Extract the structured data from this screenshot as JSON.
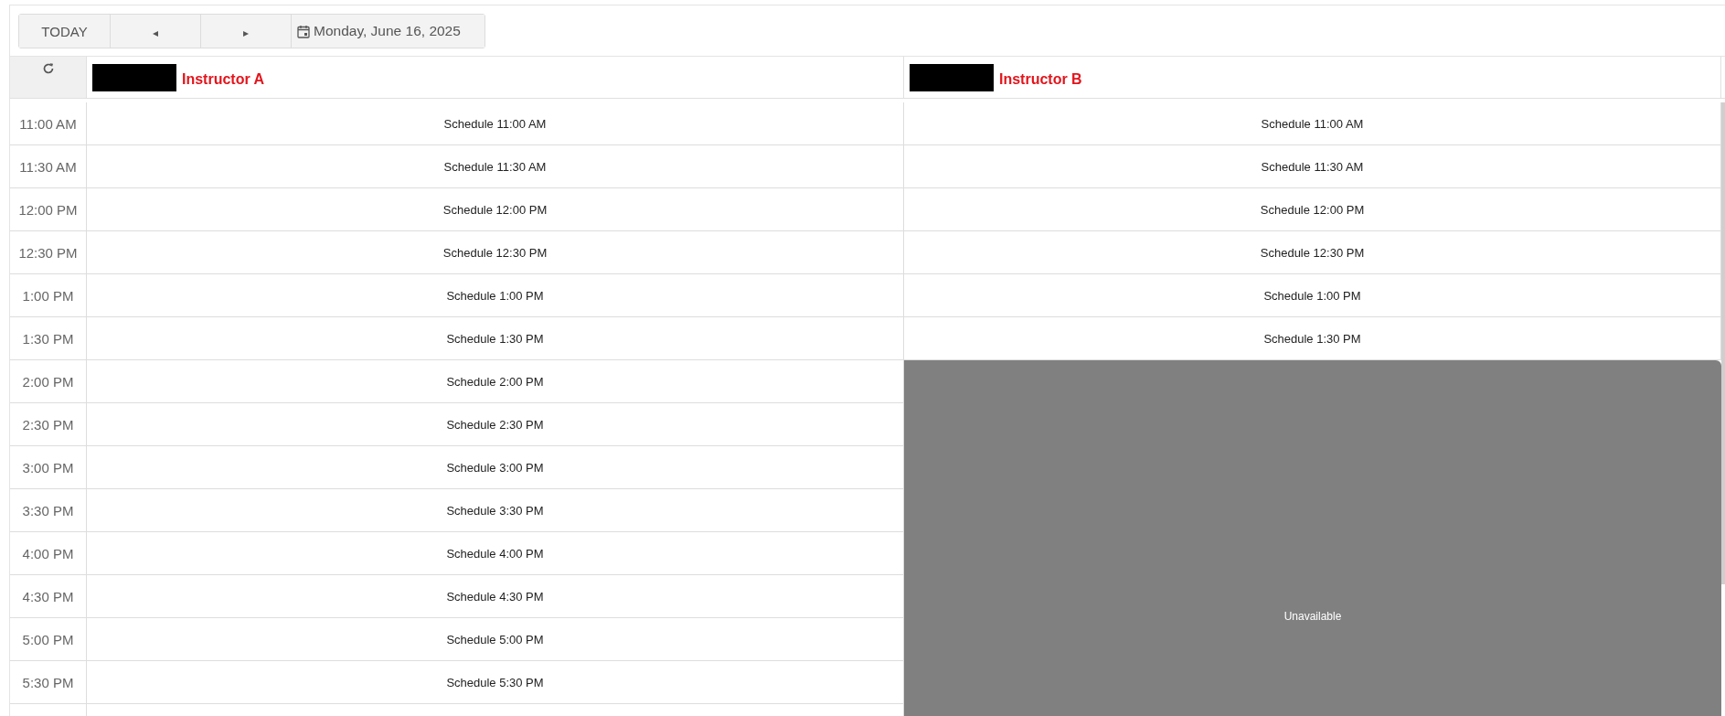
{
  "toolbar": {
    "today": "TODAY",
    "prev": "◂",
    "next": "▸",
    "date": "Monday, June 16, 2025"
  },
  "resources": [
    {
      "name": "Instructor A",
      "slots": [
        {
          "kind": "open",
          "label": "Schedule 11:00 AM"
        },
        {
          "kind": "open",
          "label": "Schedule 11:30 AM"
        },
        {
          "kind": "open",
          "label": "Schedule 12:00 PM"
        },
        {
          "kind": "open",
          "label": "Schedule 12:30 PM"
        },
        {
          "kind": "open",
          "label": "Schedule 1:00 PM"
        },
        {
          "kind": "open",
          "label": "Schedule 1:30 PM"
        },
        {
          "kind": "open",
          "label": "Schedule 2:00 PM"
        },
        {
          "kind": "open",
          "label": "Schedule 2:30 PM"
        },
        {
          "kind": "open",
          "label": "Schedule 3:00 PM"
        },
        {
          "kind": "open",
          "label": "Schedule 3:30 PM"
        },
        {
          "kind": "open",
          "label": "Schedule 4:00 PM"
        },
        {
          "kind": "open",
          "label": "Schedule 4:30 PM"
        },
        {
          "kind": "open",
          "label": "Schedule 5:00 PM"
        },
        {
          "kind": "open",
          "label": "Schedule 5:30 PM"
        }
      ]
    },
    {
      "name": "Instructor B",
      "slots": [
        {
          "kind": "open",
          "label": "Schedule 11:00 AM"
        },
        {
          "kind": "open",
          "label": "Schedule 11:30 AM"
        },
        {
          "kind": "open",
          "label": "Schedule 12:00 PM"
        },
        {
          "kind": "open",
          "label": "Schedule 12:30 PM"
        },
        {
          "kind": "open",
          "label": "Schedule 1:00 PM"
        },
        {
          "kind": "open",
          "label": "Schedule 1:30 PM"
        },
        {
          "kind": "unavailable",
          "label": "Unavailable"
        }
      ]
    }
  ],
  "times": [
    "11:00 AM",
    "11:30 AM",
    "12:00 PM",
    "12:30 PM",
    "1:00 PM",
    "1:30 PM",
    "2:00 PM",
    "2:30 PM",
    "3:00 PM",
    "3:30 PM",
    "4:00 PM",
    "4:30 PM",
    "5:00 PM",
    "5:30 PM"
  ]
}
